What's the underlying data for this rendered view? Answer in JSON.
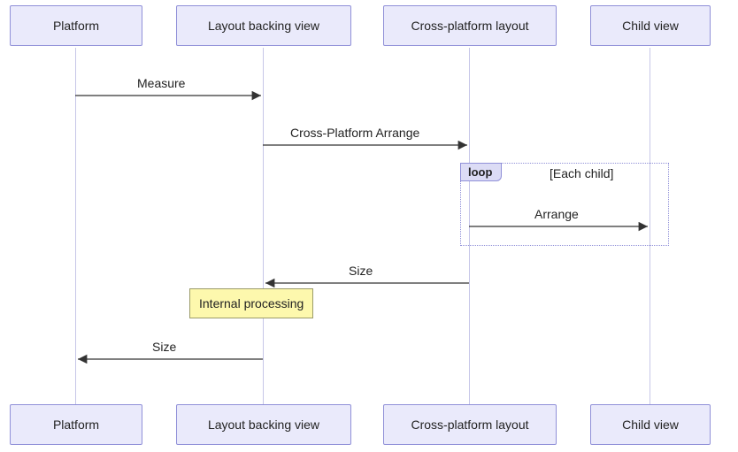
{
  "participants": {
    "platform": "Platform",
    "layout_backing_view": "Layout backing view",
    "cross_platform_layout": "Cross-platform layout",
    "child_view": "Child view"
  },
  "messages": {
    "measure": "Measure",
    "cross_platform_arrange": "Cross-Platform Arrange",
    "arrange": "Arrange",
    "size_1": "Size",
    "size_2": "Size"
  },
  "note": {
    "internal_processing": "Internal processing"
  },
  "loop": {
    "tag": "loop",
    "title": "[Each child]"
  },
  "chart_data": {
    "type": "sequence_diagram",
    "participants": [
      "Platform",
      "Layout backing view",
      "Cross-platform layout",
      "Child view"
    ],
    "interactions": [
      {
        "from": "Platform",
        "to": "Layout backing view",
        "label": "Measure"
      },
      {
        "from": "Layout backing view",
        "to": "Cross-platform layout",
        "label": "Cross-Platform Arrange"
      },
      {
        "fragment": "loop",
        "condition": "Each child",
        "interactions": [
          {
            "from": "Cross-platform layout",
            "to": "Child view",
            "label": "Arrange"
          }
        ]
      },
      {
        "from": "Cross-platform layout",
        "to": "Layout backing view",
        "label": "Size"
      },
      {
        "note_over": "Layout backing view",
        "text": "Internal processing"
      },
      {
        "from": "Layout backing view",
        "to": "Platform",
        "label": "Size"
      }
    ]
  }
}
